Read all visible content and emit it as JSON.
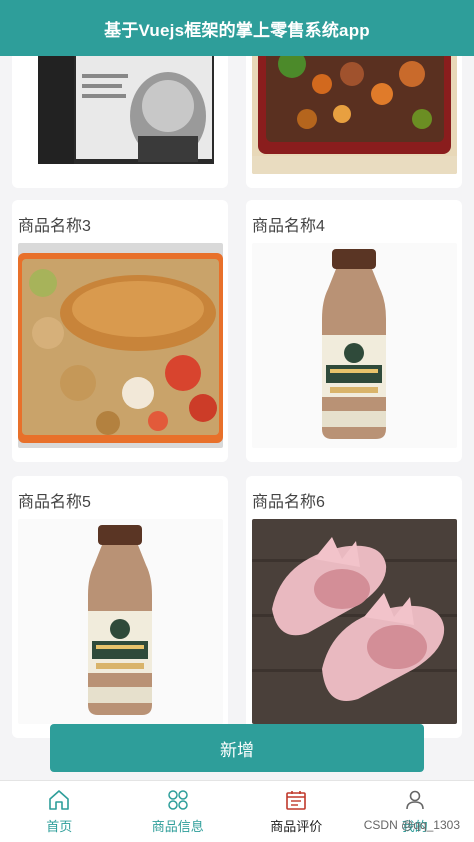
{
  "header": {
    "title": "基于Vuejs框架的掌上零售系统app"
  },
  "products": [
    {
      "name": "商品名称3",
      "image": "fried-chicken-bento-photo"
    },
    {
      "name": "商品名称4",
      "image": "milk-tea-bottle-photo"
    },
    {
      "name": "商品名称5",
      "image": "milk-tea-bottle-photo"
    },
    {
      "name": "商品名称6",
      "image": "pink-kids-shoes-photo"
    }
  ],
  "top_row_images": [
    "book-portrait-cover-photo",
    "kung-pao-bento-photo"
  ],
  "actions": {
    "add_label": "新增"
  },
  "tabbar": {
    "items": [
      {
        "label": "首页",
        "icon": "home-icon"
      },
      {
        "label": "商品信息",
        "icon": "grid-icon"
      },
      {
        "label": "商品评价",
        "icon": "calendar-icon"
      },
      {
        "label": "我的",
        "icon": "user-icon"
      }
    ]
  },
  "watermark": "CSDN @qq_1303",
  "colors": {
    "accent": "#2e9e9a",
    "active_tab": "#c0392b"
  }
}
